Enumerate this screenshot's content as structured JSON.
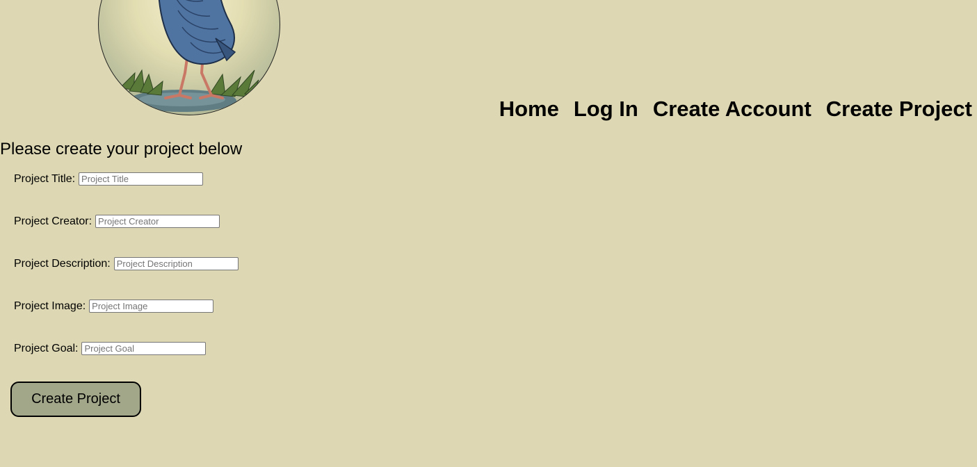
{
  "logo": {
    "icon": "pukeko-bird-logo"
  },
  "nav": {
    "items": [
      {
        "label": "Home"
      },
      {
        "label": "Log In"
      },
      {
        "label": "Create Account"
      },
      {
        "label": "Create Project"
      }
    ]
  },
  "form": {
    "heading": "Please create your project below",
    "fields": [
      {
        "label": "Project Title:",
        "placeholder": "Project Title",
        "value": ""
      },
      {
        "label": "Project Creator:",
        "placeholder": "Project Creator",
        "value": ""
      },
      {
        "label": "Project Description:",
        "placeholder": "Project Description",
        "value": ""
      },
      {
        "label": "Project Image:",
        "placeholder": "Project Image",
        "value": ""
      },
      {
        "label": "Project Goal:",
        "placeholder": "Project Goal",
        "value": ""
      }
    ],
    "submit_label": "Create Project"
  },
  "colors": {
    "background": "#ddd8b3",
    "button": "#a2a78a"
  }
}
